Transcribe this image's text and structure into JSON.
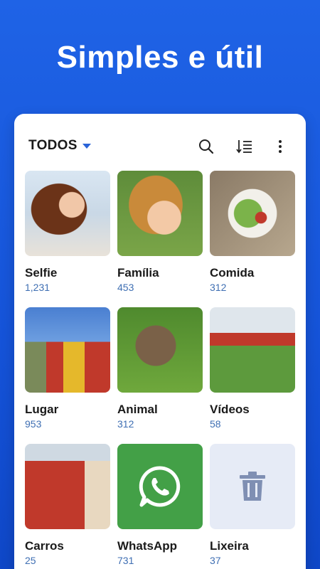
{
  "headline": "Simples e útil",
  "toolbar": {
    "filter_label": "TODOS",
    "icons": [
      "search-icon",
      "sort-icon",
      "more-vert-icon"
    ]
  },
  "albums": [
    {
      "name": "Selfie",
      "count": "1,231"
    },
    {
      "name": "Família",
      "count": "453"
    },
    {
      "name": "Comida",
      "count": "312"
    },
    {
      "name": "Lugar",
      "count": "953"
    },
    {
      "name": "Animal",
      "count": "312"
    },
    {
      "name": "Vídeos",
      "count": "58"
    },
    {
      "name": "Carros",
      "count": "25"
    },
    {
      "name": "WhatsApp",
      "count": "731"
    },
    {
      "name": "Lixeira",
      "count": "37"
    }
  ],
  "colors": {
    "background": "#1553d8",
    "card": "#ffffff",
    "count_text": "#3f6fb3",
    "caret": "#2a63d8",
    "whatsapp_tile": "#43a047",
    "trash_tile": "#e6ebf6",
    "trash_icon": "#7f8fb3"
  }
}
